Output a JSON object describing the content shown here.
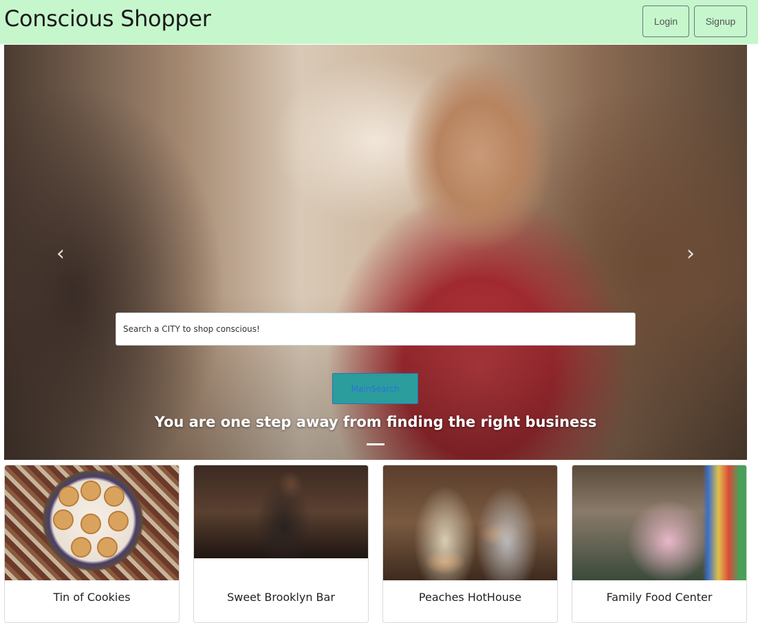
{
  "navbar": {
    "brand": "Conscious Shopper",
    "login_label": "Login",
    "signup_label": "Signup"
  },
  "hero": {
    "search_placeholder": "Search a CITY to shop conscious!",
    "main_search_label": "MainSearch",
    "caption": "You are one step away from finding the right business",
    "prev_icon": "chevron-left-icon",
    "next_icon": "chevron-right-icon"
  },
  "cards": [
    {
      "title": "Tin of Cookies"
    },
    {
      "title": "Sweet Brooklyn Bar"
    },
    {
      "title": "Peaches HotHouse"
    },
    {
      "title": "Family Food Center"
    }
  ],
  "colors": {
    "navbar_bg": "#c6f7cc",
    "main_search_bg": "#2a9d9c",
    "main_search_text": "#2f6fe0"
  }
}
